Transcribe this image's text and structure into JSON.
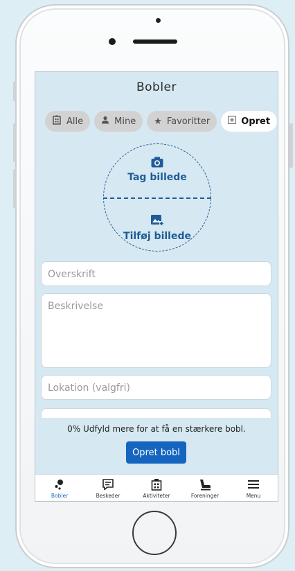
{
  "header": {
    "title": "Bobler"
  },
  "tabs": [
    {
      "label": "Alle",
      "icon": "building-icon"
    },
    {
      "label": "Mine",
      "icon": "person-icon"
    },
    {
      "label": "Favoritter",
      "icon": "star-icon"
    },
    {
      "label": "Opret",
      "icon": "plus-box-icon",
      "active": true
    }
  ],
  "photo": {
    "take_label": "Tag billede",
    "add_label": "Tilføj billede"
  },
  "form": {
    "title_placeholder": "Overskrift",
    "description_placeholder": "Beskrivelse",
    "location_placeholder": "Lokation (valgfri)"
  },
  "progress": {
    "value": "0%",
    "message": "Udfyld mere for at få en stærkere bobl."
  },
  "submit_label": "Opret bobl",
  "nav": [
    {
      "label": "Bobler",
      "active": true
    },
    {
      "label": "Beskeder"
    },
    {
      "label": "Aktiviteter"
    },
    {
      "label": "Foreninger"
    },
    {
      "label": "Menu"
    }
  ],
  "colors": {
    "accent": "#1565c0",
    "background": "#d6e8f1",
    "photo_stroke": "#1f5c99"
  }
}
